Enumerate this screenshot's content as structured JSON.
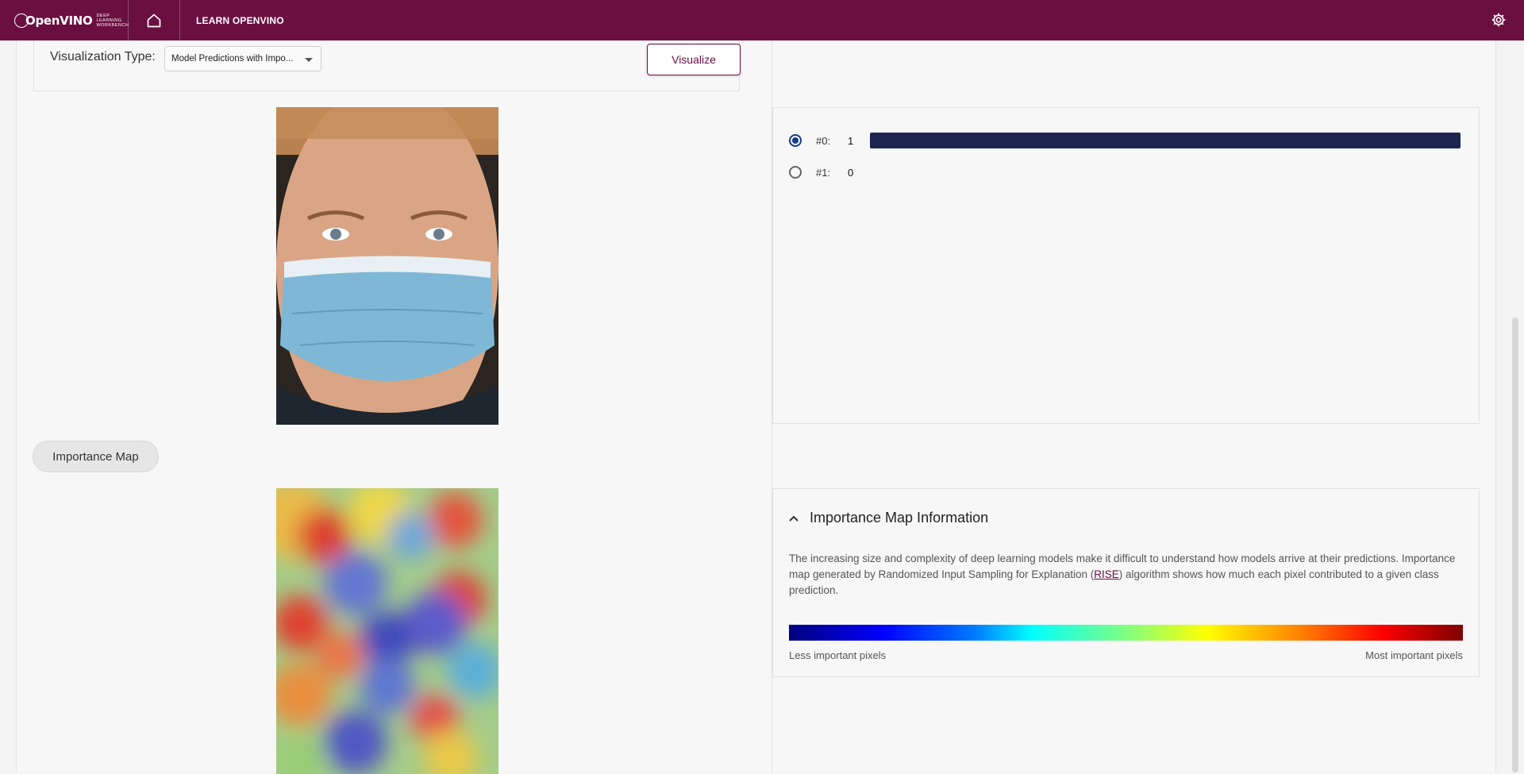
{
  "topbar": {
    "logo_text": "OpenVINO",
    "logo_sub_line1": "Deep Learning",
    "logo_sub_line2": "Workbench",
    "learn_link": "LEARN OPENVINO",
    "home_icon": "home-icon",
    "settings_icon": "gear-icon"
  },
  "toolbar": {
    "visualization_type_label": "Visualization Type:",
    "visualization_type_value": "Model Predictions with Impo...",
    "visualize_button": "Visualize"
  },
  "importance_map_chip": "Importance Map",
  "predictions": [
    {
      "key": "#0:",
      "value": "1",
      "selected": true,
      "score": 1
    },
    {
      "key": "#1:",
      "value": "0",
      "selected": false,
      "score": 0
    }
  ],
  "info": {
    "title": "Importance Map Information",
    "text_before_link": "The increasing size and complexity of deep learning models make it difficult to understand how models arrive at their predictions. Importance map generated by Randomized Input Sampling for Explanation (",
    "link_text": "RISE",
    "text_after_link": ") algorithm shows how much each pixel contributed to a given class prediction.",
    "less_label": "Less important pixels",
    "most_label": "Most important pixels"
  },
  "colors": {
    "brand": "#6a0f40",
    "bar": "#1c2550",
    "radio_selected": "#1a3a8f"
  }
}
